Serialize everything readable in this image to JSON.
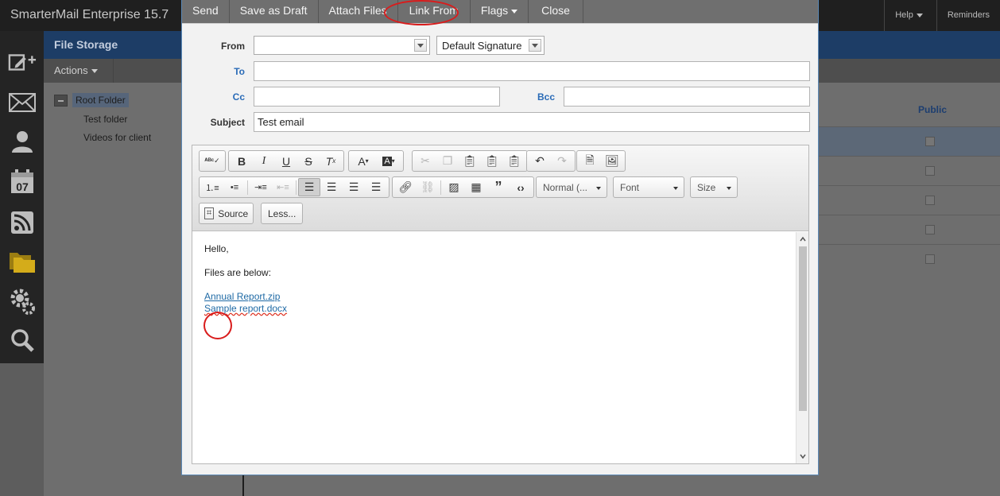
{
  "app": {
    "title": "SmarterMail Enterprise 15.7",
    "top_right": {
      "help": "Help",
      "reminders": "Reminders"
    }
  },
  "file_storage": {
    "title": "File Storage",
    "actions_label": "Actions",
    "tree": {
      "root": "Root Folder",
      "children": [
        "Test folder",
        "Videos for client"
      ]
    },
    "grid": {
      "public_header": "Public"
    }
  },
  "compose": {
    "toolbar": {
      "send": "Send",
      "save_draft": "Save as Draft",
      "attach_files": "Attach Files",
      "link_from": "Link From",
      "flags": "Flags",
      "close": "Close"
    },
    "from": {
      "label": "From",
      "value": ""
    },
    "signature": {
      "value": "Default Signature"
    },
    "to": {
      "label": "To",
      "value": ""
    },
    "cc": {
      "label": "Cc",
      "value": ""
    },
    "bcc": {
      "label": "Bcc",
      "value": ""
    },
    "subject": {
      "label": "Subject",
      "value": "Test email"
    },
    "editor": {
      "format_combo": "Normal (...",
      "font_combo": "Font",
      "size_combo": "Size",
      "source_label": "Source",
      "less_label": "Less...",
      "body": {
        "greeting": "Hello,",
        "line": "Files are below:",
        "links": [
          "Annual Report.zip",
          "Sample report.docx"
        ]
      }
    }
  },
  "colors": {
    "accent_blue": "#1d3d66",
    "annotation_red": "#d91c1c",
    "link_blue": "#1f6aa5"
  }
}
